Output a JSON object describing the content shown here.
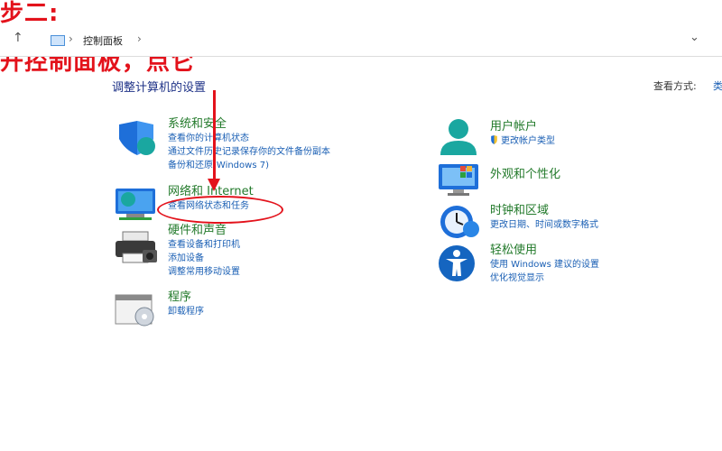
{
  "annotation": {
    "step": "步二:",
    "instruction": "开控制面板，点它"
  },
  "address_bar": {
    "crumb": "控制面板"
  },
  "page": {
    "title": "调整计算机的设置",
    "view_label": "查看方式:",
    "view_value": "类"
  },
  "left_categories": [
    {
      "title": "系统和安全",
      "links": [
        "查看你的计算机状态",
        "通过文件历史记录保存你的文件备份副本",
        "备份和还原(Windows 7)"
      ]
    },
    {
      "title": "网络和 Internet",
      "links": [
        "查看网络状态和任务"
      ]
    },
    {
      "title": "硬件和声音",
      "links": [
        "查看设备和打印机",
        "添加设备",
        "调整常用移动设置"
      ]
    },
    {
      "title": "程序",
      "links": [
        "卸载程序"
      ]
    }
  ],
  "right_categories": [
    {
      "title": "用户帐户",
      "links": [
        "更改帐户类型"
      ]
    },
    {
      "title": "外观和个性化",
      "links": []
    },
    {
      "title": "时钟和区域",
      "links": [
        "更改日期、时间或数字格式"
      ]
    },
    {
      "title": "轻松使用",
      "links": [
        "使用 Windows 建议的设置",
        "优化视觉显示"
      ]
    }
  ],
  "colors": {
    "annotation_red": "#e3121b",
    "category_green": "#237a2b",
    "link_blue": "#1a5fb4",
    "title_navy": "#1e3287"
  },
  "icons": [
    "arrow-up-icon",
    "pc-icon",
    "chevron-right-icon",
    "chevron-down-icon",
    "shield-icon",
    "network-icon",
    "printer-icon",
    "programs-icon",
    "user-icon",
    "uac-shield-icon",
    "appearance-icon",
    "clock-globe-icon",
    "accessibility-icon"
  ]
}
